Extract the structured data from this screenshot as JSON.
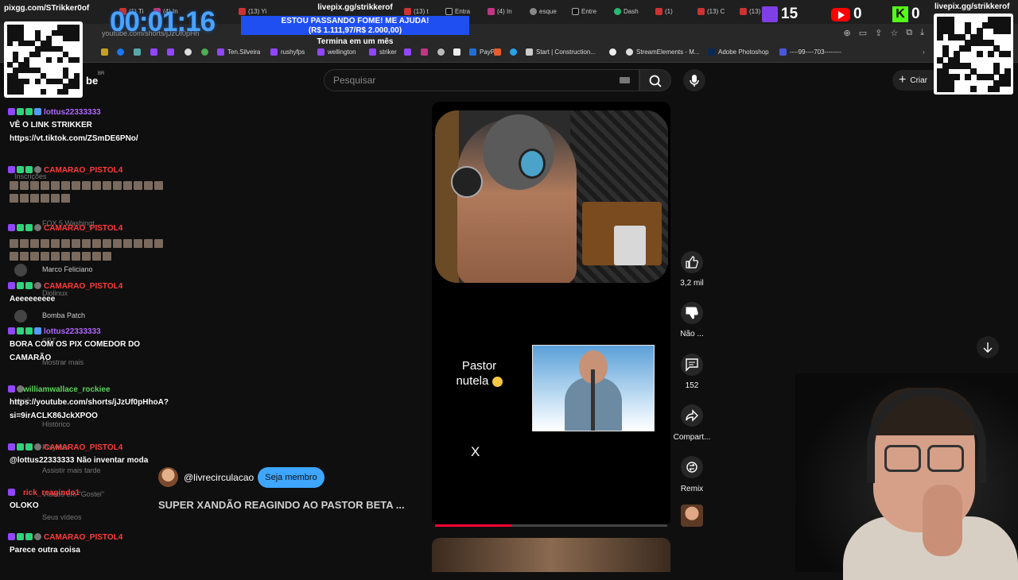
{
  "browser": {
    "tabs": [
      "(1) Ti",
      "(4) In",
      "(13) Yi",
      "(13) t",
      "(13) C",
      "Entra",
      "(4) In",
      "esque",
      "Entre",
      "Dash",
      "(1) ",
      "(13) C",
      "(13) "
    ],
    "url": "youtube.com/shorts/jJzUf0pHh",
    "bookmarks": [
      "Ten.Silveira",
      "rushyfps",
      "wellington",
      "striker",
      "PayPal",
      "Start | Construction...",
      "StreamElements - M...",
      "Adobe Photoshop",
      "----99----703--------"
    ]
  },
  "youtube": {
    "logo": "be",
    "region": "BR",
    "search_placeholder": "Pesquisar",
    "create_label": "Criar"
  },
  "short": {
    "pastor_label_line1": "Pastor",
    "pastor_label_line2": "nutela",
    "x_mark": "X",
    "channel": "@livrecirculacao",
    "member_button": "Seja membro",
    "title": "SUPER XANDÃO REAGINDO AO PASTOR BETA ...",
    "progress": 0.33,
    "actions": {
      "likes": "3,2 mil",
      "dislike": "Não ...",
      "comments": "152",
      "share": "Compart...",
      "remix": "Remix"
    }
  },
  "overlay": {
    "timer": "00:01:16",
    "livepix_top": "livepix.gg/strikkerof",
    "donation_line1": "ESTOU PASSANDO FOME! ME AJUDA!",
    "donation_line2": "(R$ 1.111,97/R$ 2.000,00)",
    "donation_deadline": "Termina em um mês",
    "pixgg": "pixgg.com/STrikker0of",
    "livepix_right": "livepix.gg/strikkerof",
    "twitch_count": "15",
    "youtube_count": "0",
    "kick_count": "0"
  },
  "chat": [
    {
      "user": "lottus22333333",
      "user_color": "#b066ff",
      "text": "VÊ O LINK STRIKKER https://vt.tiktok.com/ZSmDE6PNo/"
    },
    {
      "user": "CAMARAO_PISTOL4",
      "user_color": "#ff3b3b",
      "text": ""
    },
    {
      "user": "CAMARAO_PISTOL4",
      "user_color": "#ff3b3b",
      "text": ""
    },
    {
      "user": "CAMARAO_PISTOL4",
      "user_color": "#ff3b3b",
      "text": "Aeeeeeeeee"
    },
    {
      "user": "lottus22333333",
      "user_color": "#b066ff",
      "text": "BORA COM OS PIX COMEDOR DO CAMARÃO"
    },
    {
      "user": "williamwallace_rockiee",
      "user_color": "#5cd35c",
      "text": "https://youtube.com/shorts/jJzUf0pHhoA?si=9irACLK86JckXPOO"
    },
    {
      "user": "CAMARAO_PISTOL4",
      "user_color": "#ff3b3b",
      "text": "@lottus22333333 Não inventar moda"
    },
    {
      "user": "rick_reagindo1",
      "user_color": "#ff3b3b",
      "text": "OLOKO"
    },
    {
      "user": "CAMARAO_PISTOL4",
      "user_color": "#ff3b3b",
      "text": "Parece outra coisa"
    }
  ],
  "sidebar_ghost": [
    "Inscrições",
    "FOX 5 Washingt...",
    "Marco Feliciano",
    "Diolinux",
    "Bomba Patch",
    "SBT",
    "Mostrar mais",
    "Você",
    "Histórico",
    "Playlists",
    "Assistir mais tarde",
    "Vídeos em \"Gostei\"",
    "Seus vídeos"
  ],
  "colors": {
    "accent": "#3ea6ff",
    "youtube_red": "#ff0033",
    "timer_blue": "#4aa3ff",
    "donation_blue": "#1f4ff0"
  },
  "icons": [
    "search-icon",
    "mic-icon",
    "plus-icon",
    "thumbs-up-icon",
    "thumbs-down-icon",
    "comment-icon",
    "share-icon",
    "remix-icon",
    "arrow-down-icon",
    "keyboard-icon"
  ]
}
